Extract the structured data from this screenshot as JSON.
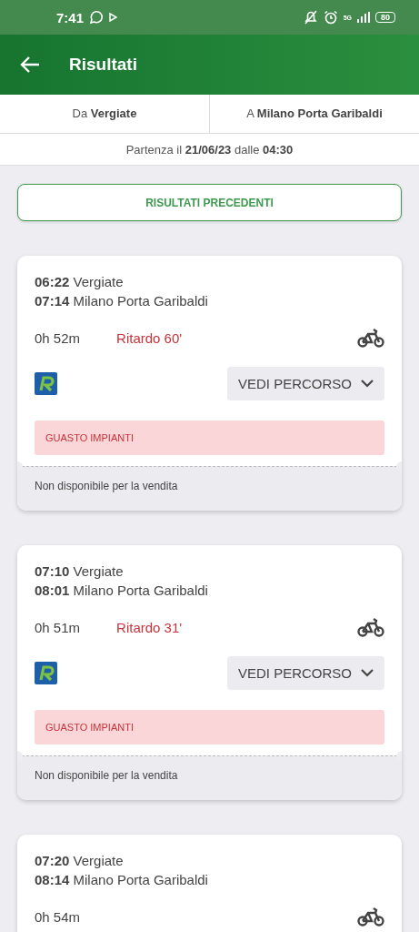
{
  "status_bar": {
    "time": "7:41",
    "network": "5G",
    "battery": "80"
  },
  "header": {
    "title": "Risultati"
  },
  "route": {
    "from_label": "Da",
    "from": "Vergiate",
    "to_label": "A",
    "to": "Milano Porta Garibaldi"
  },
  "departure": "Partenza il **21/06/23** dalle **04:30**",
  "previous_button": "RISULTATI PRECEDENTI",
  "results": [
    {
      "dep_time": "06:22",
      "dep_station": "Vergiate",
      "arr_time": "07:14",
      "arr_station": "Milano Porta Garibaldi",
      "duration": "0h 52m",
      "delay": "Ritardo 60'",
      "route_button": "VEDI PERCORSO",
      "alert": "GUASTO IMPIANTI",
      "availability": "Non disponibile per la vendita"
    },
    {
      "dep_time": "07:10",
      "dep_station": "Vergiate",
      "arr_time": "08:01",
      "arr_station": "Milano Porta Garibaldi",
      "duration": "0h 51m",
      "delay": "Ritardo 31'",
      "route_button": "VEDI PERCORSO",
      "alert": "GUASTO IMPIANTI",
      "availability": "Non disponibile per la vendita"
    },
    {
      "dep_time": "07:20",
      "dep_station": "Vergiate",
      "arr_time": "08:14",
      "arr_station": "Milano Porta Garibaldi",
      "duration": "0h 54m"
    }
  ]
}
